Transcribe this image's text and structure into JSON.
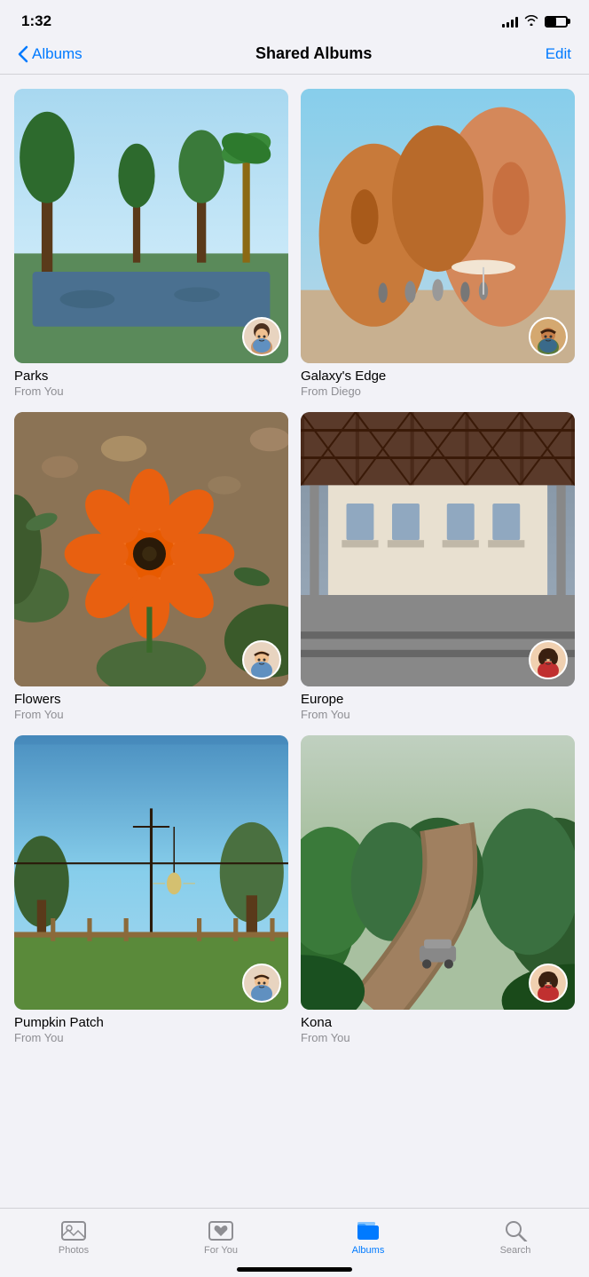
{
  "statusBar": {
    "time": "1:32",
    "signal": [
      3,
      5,
      7,
      9,
      11
    ],
    "wifi": true,
    "battery": 50
  },
  "navBar": {
    "backLabel": "Albums",
    "title": "Shared Albums",
    "editLabel": "Edit"
  },
  "albums": [
    {
      "id": "parks",
      "name": "Parks",
      "from": "From You",
      "scene": "parks",
      "avatarEmoji": "🧑"
    },
    {
      "id": "galaxys-edge",
      "name": "Galaxy's Edge",
      "from": "From Diego",
      "scene": "galaxy",
      "avatarEmoji": "👨"
    },
    {
      "id": "flowers",
      "name": "Flowers",
      "from": "From You",
      "scene": "flowers",
      "avatarEmoji": "🧑"
    },
    {
      "id": "europe",
      "name": "Europe",
      "from": "From You",
      "scene": "europe",
      "avatarEmoji": "👩"
    },
    {
      "id": "pumpkin-patch",
      "name": "Pumpkin Patch",
      "from": "From You",
      "scene": "pumpkin",
      "avatarEmoji": "🧑"
    },
    {
      "id": "kona",
      "name": "Kona",
      "from": "From You",
      "scene": "kona",
      "avatarEmoji": "👩"
    }
  ],
  "tabBar": {
    "tabs": [
      {
        "id": "photos",
        "label": "Photos",
        "active": false
      },
      {
        "id": "for-you",
        "label": "For You",
        "active": false
      },
      {
        "id": "albums",
        "label": "Albums",
        "active": true
      },
      {
        "id": "search",
        "label": "Search",
        "active": false
      }
    ]
  }
}
